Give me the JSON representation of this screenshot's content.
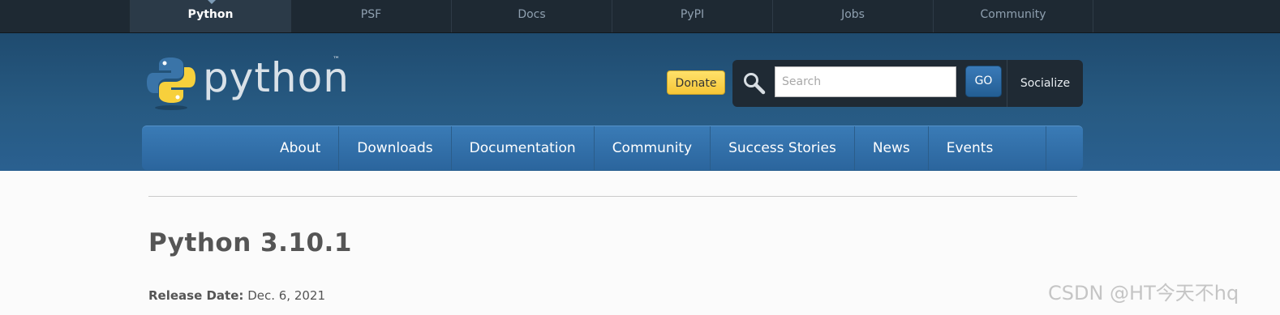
{
  "meta_nav": {
    "tabs": [
      "Python",
      "PSF",
      "Docs",
      "PyPI",
      "Jobs",
      "Community"
    ],
    "active": "Python"
  },
  "header": {
    "logo_text": "python",
    "logo_tm": "™",
    "donate_label": "Donate",
    "search_placeholder": "Search",
    "go_label": "GO",
    "socialize_label": "Socialize"
  },
  "main_nav": {
    "items": [
      "About",
      "Downloads",
      "Documentation",
      "Community",
      "Success Stories",
      "News",
      "Events"
    ]
  },
  "content": {
    "title": "Python 3.10.1",
    "release_label": "Release Date:",
    "release_value": "Dec. 6, 2021"
  },
  "watermark": "CSDN @HT今天不hq",
  "colors": {
    "meta_nav_bg": "#1e2933",
    "header_bg": "#275a82",
    "nav_blue": "#3a7bb6",
    "donate_yellow": "#f6c636"
  }
}
